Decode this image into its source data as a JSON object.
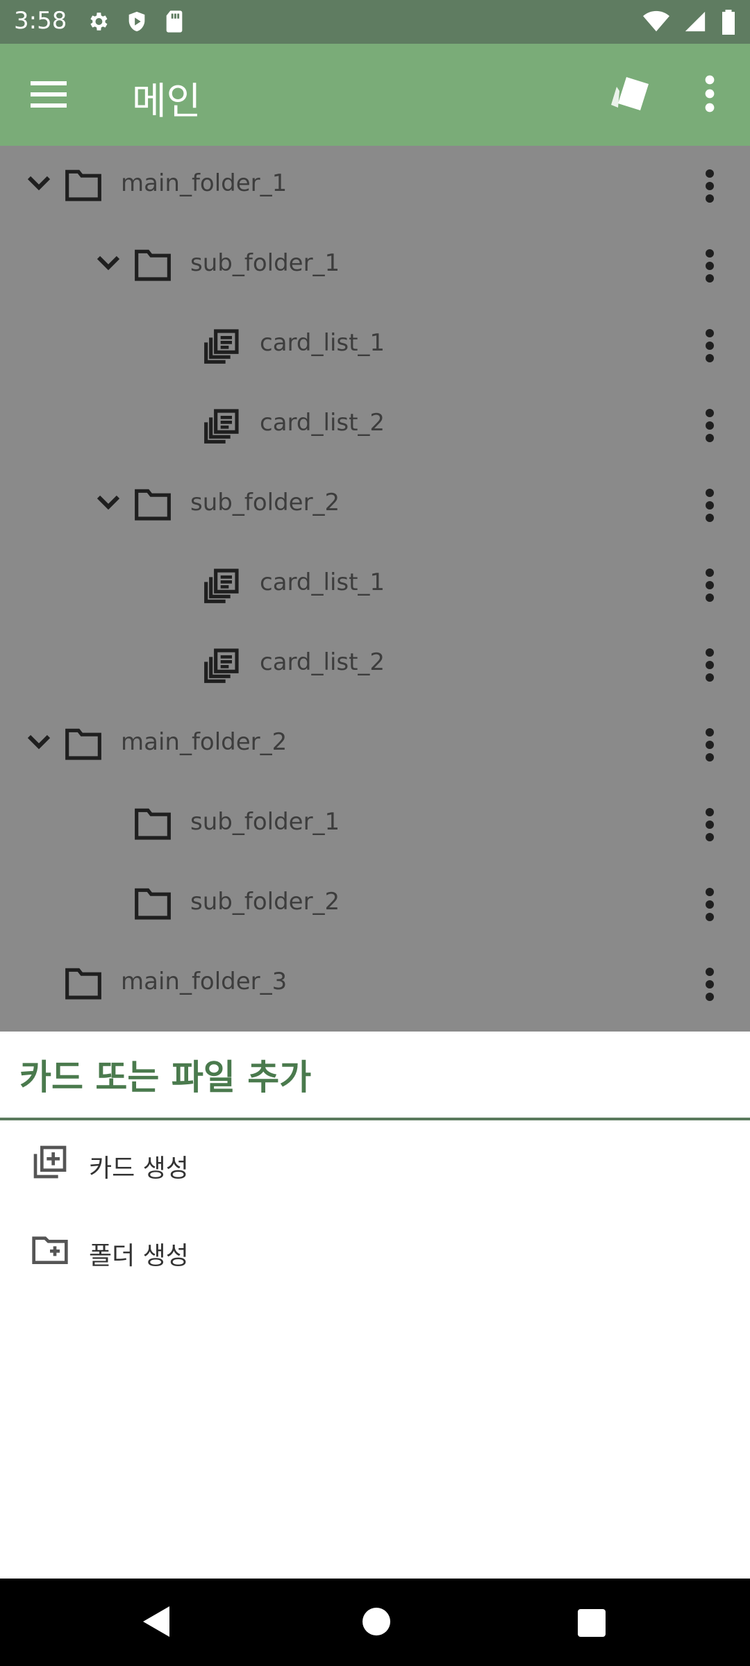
{
  "status": {
    "time": "3:58"
  },
  "appbar": {
    "title": "메인"
  },
  "tree": [
    {
      "label": "main_folder_1",
      "type": "folder",
      "level": 0,
      "expanded": true
    },
    {
      "label": "sub_folder_1",
      "type": "folder",
      "level": 1,
      "expanded": true
    },
    {
      "label": "card_list_1",
      "type": "list",
      "level": 2
    },
    {
      "label": "card_list_2",
      "type": "list",
      "level": 2
    },
    {
      "label": "sub_folder_2",
      "type": "folder",
      "level": 1,
      "expanded": true
    },
    {
      "label": "card_list_1",
      "type": "list",
      "level": 2
    },
    {
      "label": "card_list_2",
      "type": "list",
      "level": 2
    },
    {
      "label": "main_folder_2",
      "type": "folder",
      "level": 0,
      "expanded": true
    },
    {
      "label": "sub_folder_1",
      "type": "folder",
      "level": 1,
      "expanded": false
    },
    {
      "label": "sub_folder_2",
      "type": "folder",
      "level": 1,
      "expanded": false
    },
    {
      "label": "main_folder_3",
      "type": "folder",
      "level": 0,
      "expanded": false
    }
  ],
  "sheet": {
    "title": "카드 또는 파일 추가",
    "items": [
      {
        "label": "카드 생성",
        "icon": "add-card-icon"
      },
      {
        "label": "폴더 생성",
        "icon": "create-folder-icon"
      }
    ]
  },
  "colors": {
    "appbar": "#7aac78",
    "statusbar": "#5f7c61",
    "accent": "#4a7a4d",
    "scrim": "#8a8a8a"
  }
}
